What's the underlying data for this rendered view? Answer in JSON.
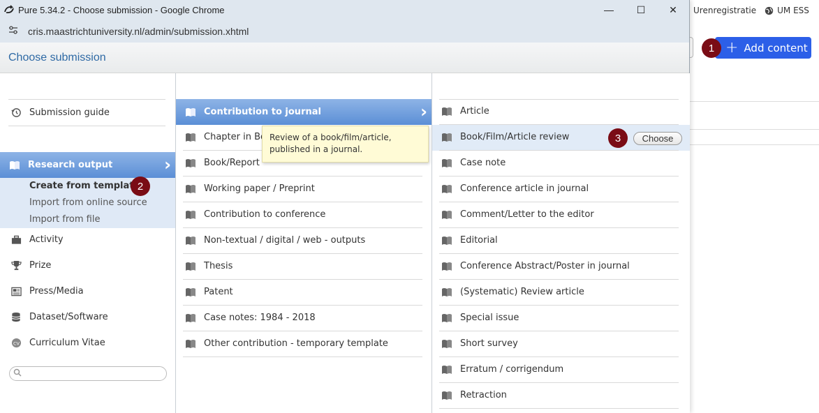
{
  "window": {
    "title": "Pure 5.34.2 - Choose submission - Google Chrome",
    "url": "cris.maastrichtuniversity.nl/admin/submission.xhtml",
    "minimize": "—",
    "maximize": "☐",
    "close": "✕"
  },
  "dialog": {
    "title": "Choose submission"
  },
  "background": {
    "nav_items": [
      "Urenregistratie",
      "UM ESS"
    ],
    "add_content_label": "Add content"
  },
  "badges": [
    "1",
    "2",
    "3"
  ],
  "column1": {
    "items": [
      {
        "label": "Submission guide",
        "icon": "history-icon"
      },
      {
        "label": "Research output",
        "icon": "book-icon"
      },
      {
        "label": "Activity",
        "icon": "briefcase-icon"
      },
      {
        "label": "Prize",
        "icon": "trophy-icon"
      },
      {
        "label": "Press/Media",
        "icon": "newspaper-icon"
      },
      {
        "label": "Dataset/Software",
        "icon": "database-icon"
      },
      {
        "label": "Curriculum Vitae",
        "icon": "cv-icon"
      }
    ],
    "sub_items": [
      "Create from template",
      "Import from online source",
      "Import from file"
    ],
    "search_placeholder": ""
  },
  "column2": {
    "items": [
      "Contribution to journal",
      "Chapter in Book/Report/Conference proceeding",
      "Book/Report",
      "Working paper / Preprint",
      "Contribution to conference",
      "Non-textual / digital / web - outputs",
      "Thesis",
      "Patent",
      "Case notes: 1984 - 2018",
      "Other contribution - temporary template"
    ],
    "chapter_visible": "Chapter in Boo"
  },
  "column3": {
    "items": [
      "Article",
      "Book/Film/Article review",
      "Case note",
      "Conference article in journal",
      "Comment/Letter to the editor",
      "Editorial",
      "Conference Abstract/Poster in journal",
      "(Systematic) Review article",
      "Special issue",
      "Short survey",
      "Erratum / corrigendum",
      "Retraction"
    ],
    "choose_label": "Choose"
  },
  "tooltip": {
    "text": "Review of a book/film/article, published in a journal."
  },
  "colors": {
    "accent": "#2c5fe8",
    "selected": "#5b8fd6",
    "badge": "#7a0c15",
    "header_text": "#2f6aa5"
  }
}
